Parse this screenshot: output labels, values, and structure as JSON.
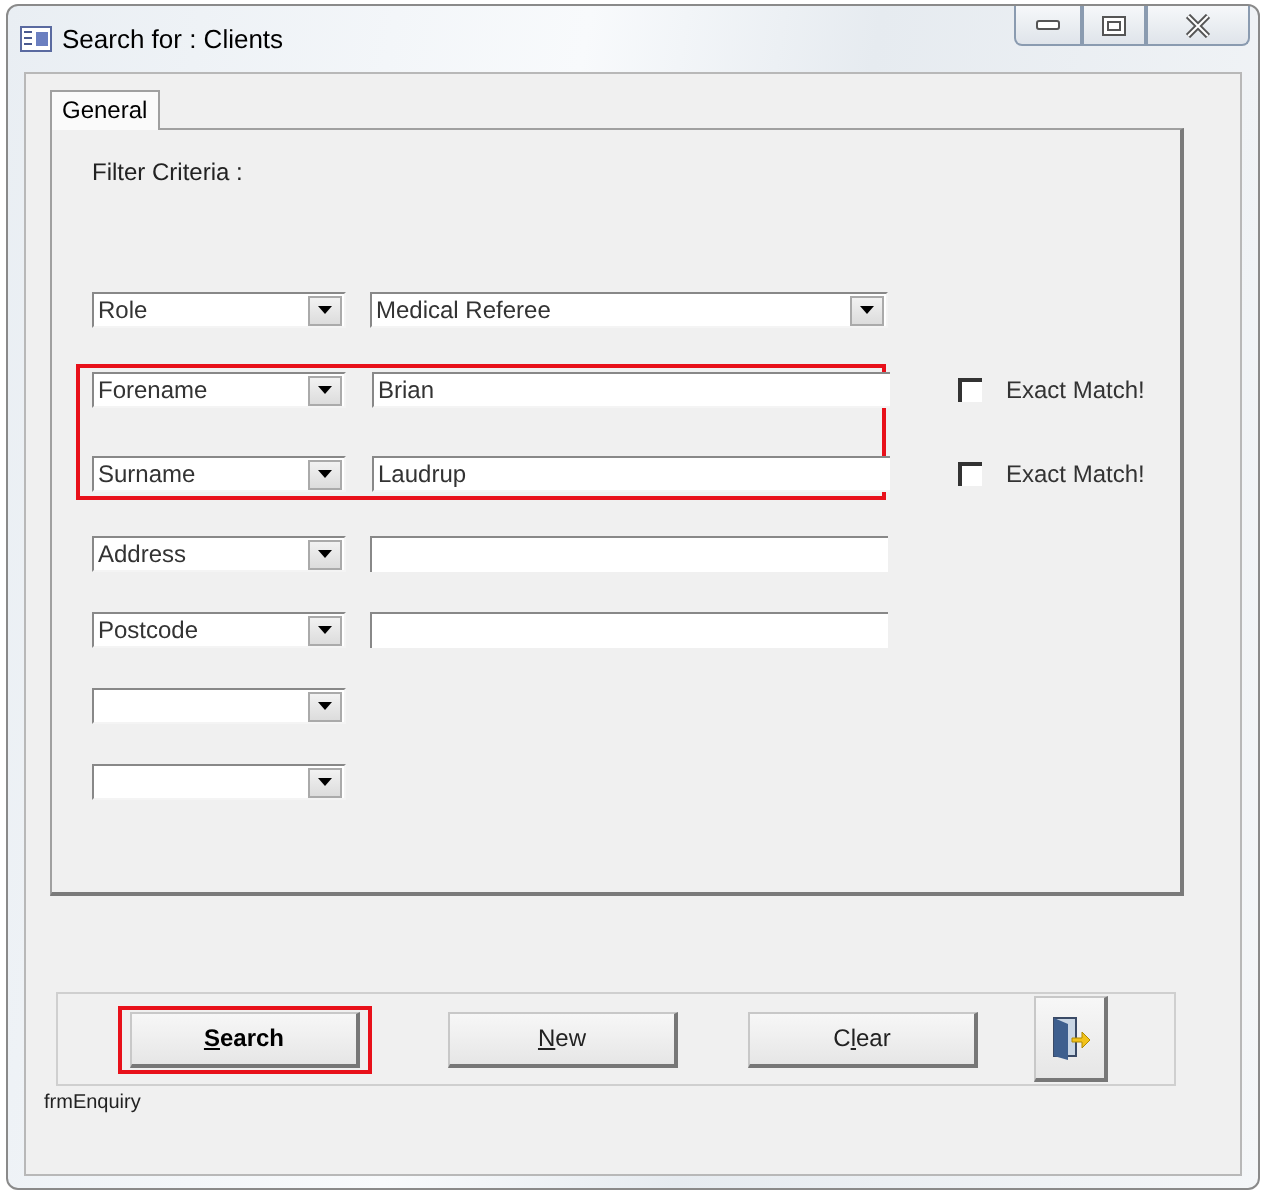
{
  "window": {
    "title": "Search for : Clients"
  },
  "tabs": [
    {
      "label": "General",
      "selected": true
    }
  ],
  "filter_heading": "Filter Criteria :",
  "criteria": [
    {
      "field": "Role",
      "kind": "dropdown",
      "value": "Medical Referee",
      "highlighted": false
    },
    {
      "field": "Forename",
      "kind": "text",
      "value": "Brian",
      "highlighted": true,
      "exact_match": {
        "label": "Exact Match!",
        "checked": false
      }
    },
    {
      "field": "Surname",
      "kind": "text",
      "value": "Laudrup",
      "highlighted": true,
      "exact_match": {
        "label": "Exact Match!",
        "checked": false
      }
    },
    {
      "field": "Address",
      "kind": "text",
      "highlighted": false
    },
    {
      "field": "Postcode",
      "kind": "text",
      "highlighted": false
    },
    {
      "kind": "none",
      "highlighted": false
    },
    {
      "kind": "none",
      "highlighted": false
    }
  ],
  "buttons": [
    {
      "kind": "text",
      "label": {
        "key": "S",
        "post": "earch"
      },
      "bold": true,
      "highlighted": true
    },
    {
      "kind": "text",
      "label": {
        "key": "N",
        "post": "ew"
      },
      "bold": false,
      "highlighted": false
    },
    {
      "kind": "text",
      "label": {
        "pre": "C",
        "key": "l",
        "post": "ear"
      },
      "bold": false,
      "highlighted": false
    },
    {
      "kind": "exit",
      "highlighted": false
    }
  ],
  "form_name": "frmEnquiry"
}
